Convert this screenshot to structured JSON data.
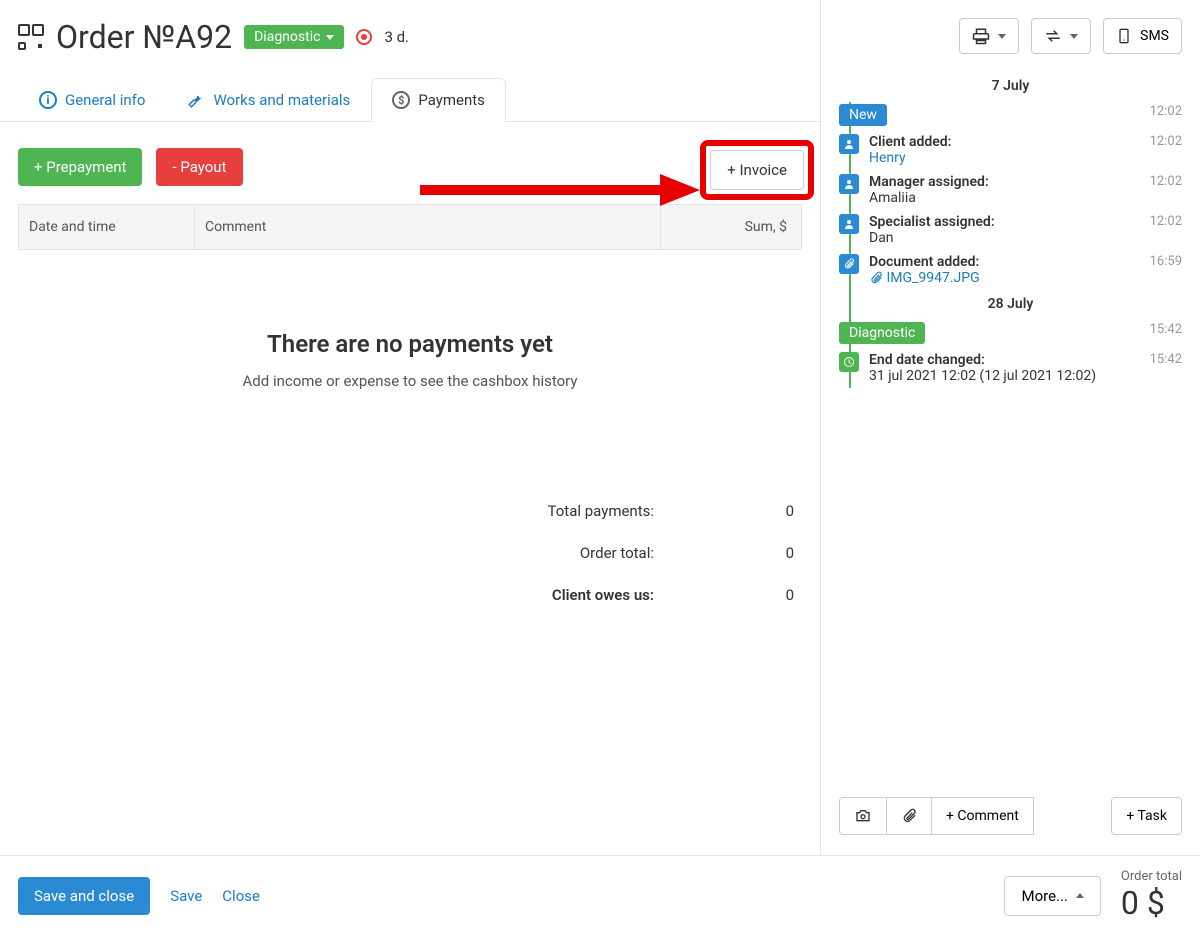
{
  "header": {
    "title": "Order №A92",
    "status": "Diagnostic",
    "duration": "3 d."
  },
  "tabs": {
    "general": "General info",
    "works": "Works and materials",
    "payments": "Payments"
  },
  "buttons": {
    "prepayment": "+ Prepayment",
    "payout": "- Payout",
    "invoice": "+ Invoice"
  },
  "table": {
    "col_date": "Date and time",
    "col_comment": "Comment",
    "col_sum": "Sum, $"
  },
  "empty": {
    "title": "There are no payments yet",
    "subtitle": "Add income or expense to see the cashbox history"
  },
  "totals": {
    "total_payments_label": "Total payments:",
    "total_payments_value": "0",
    "order_total_label": "Order total:",
    "order_total_value": "0",
    "client_owes_label": "Client owes us:",
    "client_owes_value": "0"
  },
  "side_header": {
    "sms": "SMS"
  },
  "timeline": {
    "date1": "7 July",
    "date2": "28 July",
    "entries": [
      {
        "type": "badge",
        "badge_style": "blue",
        "label": "New",
        "time": "12:02"
      },
      {
        "type": "item",
        "icon": "client",
        "title": "Client added:",
        "value": "Henry",
        "link": true,
        "time": "12:02"
      },
      {
        "type": "item",
        "icon": "person",
        "title": "Manager assigned:",
        "value": "Amaliia",
        "time": "12:02"
      },
      {
        "type": "item",
        "icon": "person",
        "title": "Specialist assigned:",
        "value": "Dan",
        "time": "12:02"
      },
      {
        "type": "item",
        "icon": "clip",
        "title": "Document added:",
        "value": "IMG_9947.JPG",
        "link": true,
        "attach_icon": true,
        "time": "16:59"
      },
      {
        "type": "badge",
        "badge_style": "green",
        "label": "Diagnostic",
        "time": "15:42"
      },
      {
        "type": "item",
        "icon": "clock",
        "icon_style": "green",
        "title": "End date changed:",
        "value": "31 jul 2021 12:02 (12 jul 2021 12:02)",
        "time": "15:42"
      }
    ]
  },
  "side_footer": {
    "comment": "+ Comment",
    "task": "+ Task"
  },
  "footer": {
    "save_close": "Save and close",
    "save": "Save",
    "close": "Close",
    "more": "More...",
    "order_total_label": "Order total",
    "order_total_value": "0 $"
  }
}
